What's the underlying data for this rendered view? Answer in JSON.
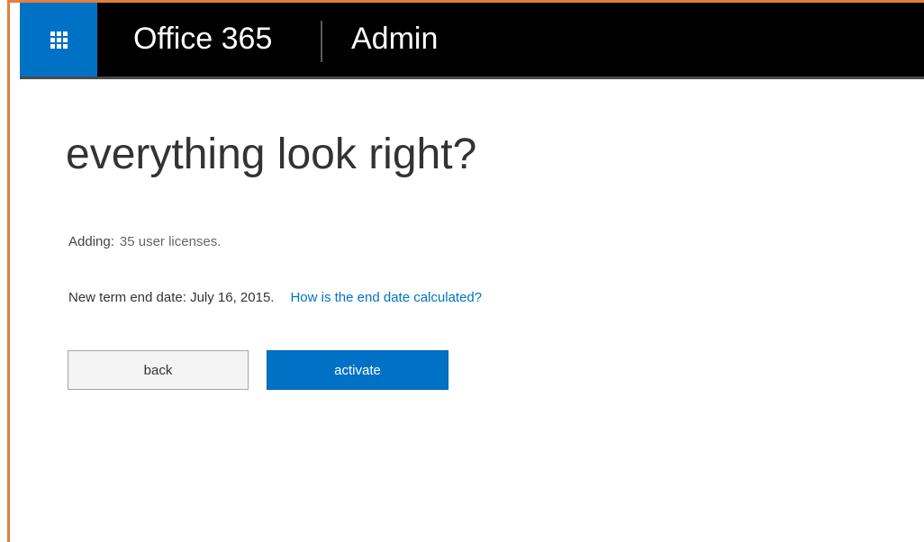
{
  "colors": {
    "accent": "#0072c6",
    "topbar": "#000000",
    "frame": "#e3803a"
  },
  "header": {
    "app_launcher_icon": "waffle-grid-icon",
    "brand": "Office 365",
    "section": "Admin"
  },
  "main": {
    "title": "everything look right?",
    "adding_label": "Adding:",
    "adding_value": "35 user licenses.",
    "term_text": "New term end date: July 16, 2015.",
    "term_link": "How is the end date calculated?",
    "back_label": "back",
    "activate_label": "activate"
  }
}
